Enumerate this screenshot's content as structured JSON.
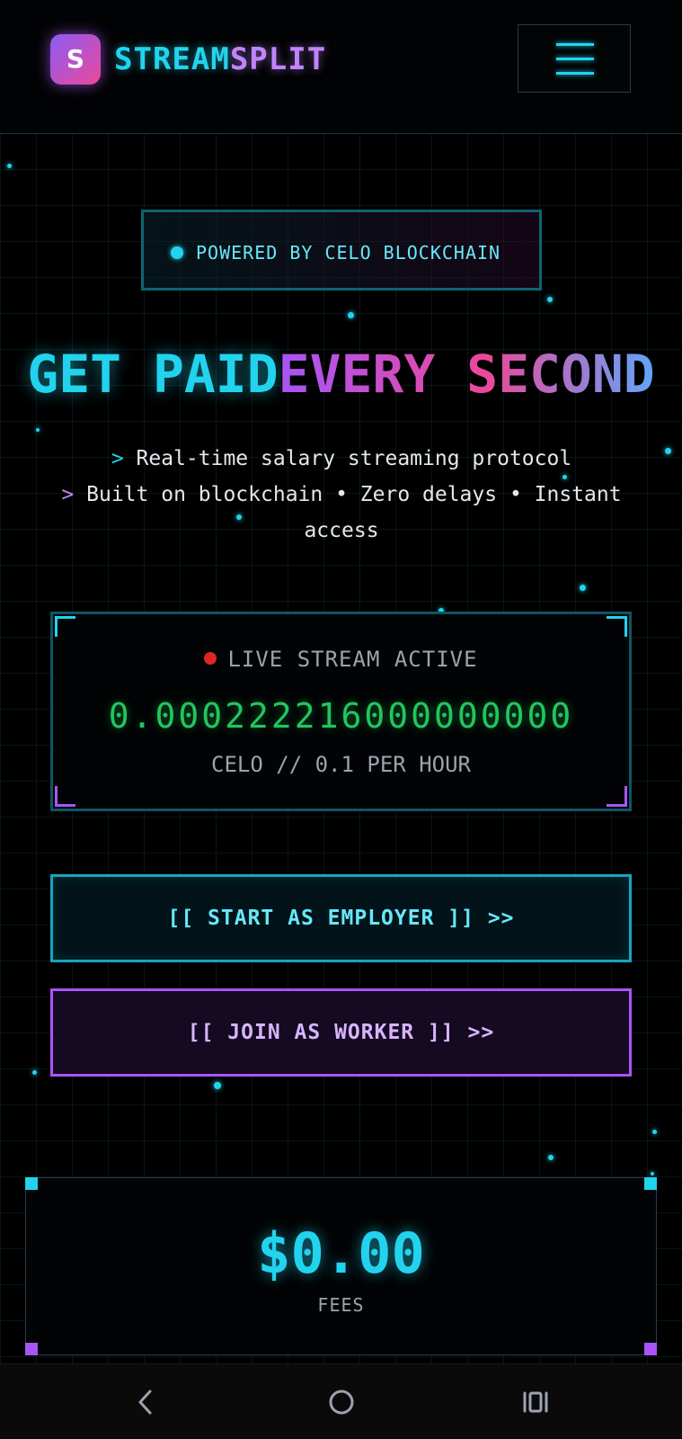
{
  "header": {
    "logo_letter": "S",
    "brand_part1": "STREAM",
    "brand_part2": "SPLIT",
    "menu_icon": "hamburger-menu-icon"
  },
  "hero": {
    "badge_text": "POWERED BY CELO BLOCKCHAIN",
    "headline_part1": "GET PAID",
    "headline_part2": "EVERY SECOND",
    "sub_line1_prefix": ">",
    "sub_line1": "Real-time salary streaming protocol",
    "sub_line2_prefix": ">",
    "sub_line2": "Built on blockchain • Zero delays • Instant access"
  },
  "live_stream": {
    "status": "LIVE STREAM ACTIVE",
    "value": "0.000222216000000000",
    "rate": "CELO // 0.1 PER HOUR"
  },
  "actions": {
    "employer_label": "[[ START AS EMPLOYER ]] >>",
    "worker_label": "[[ JOIN AS WORKER ]] >>"
  },
  "stats": {
    "fees_value": "$0.00",
    "fees_label": "FEES"
  },
  "system_nav": {
    "back_icon": "back-chevron-icon",
    "home_icon": "home-circle-icon",
    "recent_icon": "recent-apps-icon"
  },
  "colors": {
    "accent_cyan": "#22d3ee",
    "accent_purple": "#a855f7",
    "live_green": "#22c55e",
    "live_red": "#dc2626"
  }
}
